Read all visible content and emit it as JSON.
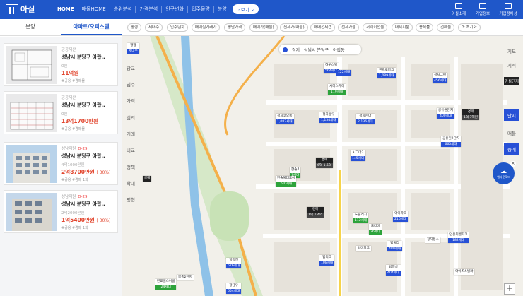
{
  "app": {
    "name": "아실"
  },
  "nav": [
    "HOME",
    "매물HOME",
    "순위분석",
    "가격분석",
    "인구변화",
    "입주물량",
    "분양"
  ],
  "more_label": "더보기",
  "top_icons": [
    "아실소개",
    "기업정보",
    "기업정체성"
  ],
  "tabs": [
    "분양",
    "아파트/오피스텔"
  ],
  "cards": [
    {
      "cat": "공공재산",
      "dday": "",
      "title": "성남시 분당구 아랍..",
      "old": "0원",
      "price": "11억원",
      "pct": "",
      "meta": "#공용 #경매물"
    },
    {
      "cat": "공공재산",
      "dday": "",
      "title": "성남시 분당구 아랍..",
      "old": "0원",
      "price": "13억1700만원",
      "pct": "",
      "meta": "#공용 #경매물"
    },
    {
      "cat": "성남지원",
      "dday": "D-29",
      "title": "성남시 분당구 아랍..",
      "old": "4억1000만원",
      "price": "2억8700만원",
      "pct": "( 30%)",
      "meta": "#공용 #경매 1회"
    },
    {
      "cat": "성남지원",
      "dday": "D-29",
      "title": "성남시 분당구 아랍..",
      "old": "2억2000만원",
      "price": "1억5400만원",
      "pct": "( 30%)",
      "meta": "#공용 #경매 1회"
    }
  ],
  "filters": [
    "평형",
    "세대수",
    "입주년차",
    "매매실거래가",
    "평단가격",
    "매매가(매물)",
    "전세가(매물)",
    "매매전세갭",
    "전세가율",
    "거래회전율",
    "대지지분",
    "용적률",
    "건폐율",
    "초기화"
  ],
  "left_rail": [
    "평형",
    "세대수",
    "광교",
    "입주",
    "가격",
    "심리",
    "거래",
    "비교",
    "정책",
    "확대",
    "평형"
  ],
  "right_rail": [
    "지도",
    "지적",
    "관심단지",
    "단지",
    "매물",
    "증개"
  ],
  "breadcrumb": [
    "경기",
    "성남시 분당구",
    "아랍동"
  ],
  "download_label": "앱다운로드",
  "map_tags": [
    {
      "t": "하우스텔",
      "b": "564세대",
      "c": "blue"
    },
    {
      "t": "",
      "b": "122세대",
      "c": "blue"
    },
    {
      "t": "시티스카이",
      "b": "119세대",
      "c": "green"
    },
    {
      "t": "판트로파크",
      "b": "1,089세대",
      "c": "blue"
    },
    {
      "t": "정자그린",
      "b": "456세대",
      "c": "blue"
    },
    {
      "t": "정자코오롱",
      "b": "1,082세대",
      "c": "blue"
    },
    {
      "t": "정자동우",
      "b": "1,134세대",
      "c": "blue"
    },
    {
      "t": "정자한다",
      "b": "2,136세대",
      "c": "blue"
    },
    {
      "t": "공유원단지",
      "b": "400세대",
      "c": "blue"
    },
    {
      "t": "경매",
      "b": "1억 7억원",
      "c": "dark"
    },
    {
      "t": "공유린2단지",
      "b": "660세대",
      "c": "blue"
    },
    {
      "t": "시그마3",
      "b": "145세대",
      "c": "blue"
    },
    {
      "t": "경매",
      "b": "6억 1.5억",
      "c": "dark"
    },
    {
      "t": "한솔7",
      "b": "1세대",
      "c": "green"
    },
    {
      "t": "한솔복대포이",
      "b": "240세대",
      "c": "green"
    },
    {
      "t": "노블리치",
      "b": "112세대",
      "c": "green"
    },
    {
      "t": "아이파크",
      "b": "216세대",
      "c": "blue"
    },
    {
      "t": "경매",
      "b": "1억 1.4억",
      "c": "dark"
    },
    {
      "t": "프리마",
      "b": "26세대",
      "c": "green"
    },
    {
      "t": "탑빌라",
      "b": "480세대",
      "c": "blue"
    },
    {
      "t": "인용디엘파크",
      "b": "182세대",
      "c": "blue"
    },
    {
      "t": "정자동스",
      "b": "",
      "c": "gray"
    },
    {
      "t": "탑마파크",
      "b": "",
      "c": "blue"
    },
    {
      "t": "탑리크",
      "b": "108세대",
      "c": "blue"
    },
    {
      "t": "탑정상",
      "b": "404세대",
      "c": "blue"
    },
    {
      "t": "힐정건",
      "b": "576세대",
      "c": "blue"
    },
    {
      "t": "아이즈스빌라",
      "b": "",
      "c": "gray"
    },
    {
      "t": "판교힐스이룸",
      "b": "24세대",
      "c": "green"
    },
    {
      "t": "봉중2단지",
      "b": "",
      "c": "blue"
    },
    {
      "t": "정담우",
      "b": "654세대",
      "c": "blue"
    },
    {
      "t": "평형",
      "b": "세대수",
      "c": "blue"
    },
    {
      "t": "공매",
      "b": "",
      "c": "dark"
    }
  ]
}
